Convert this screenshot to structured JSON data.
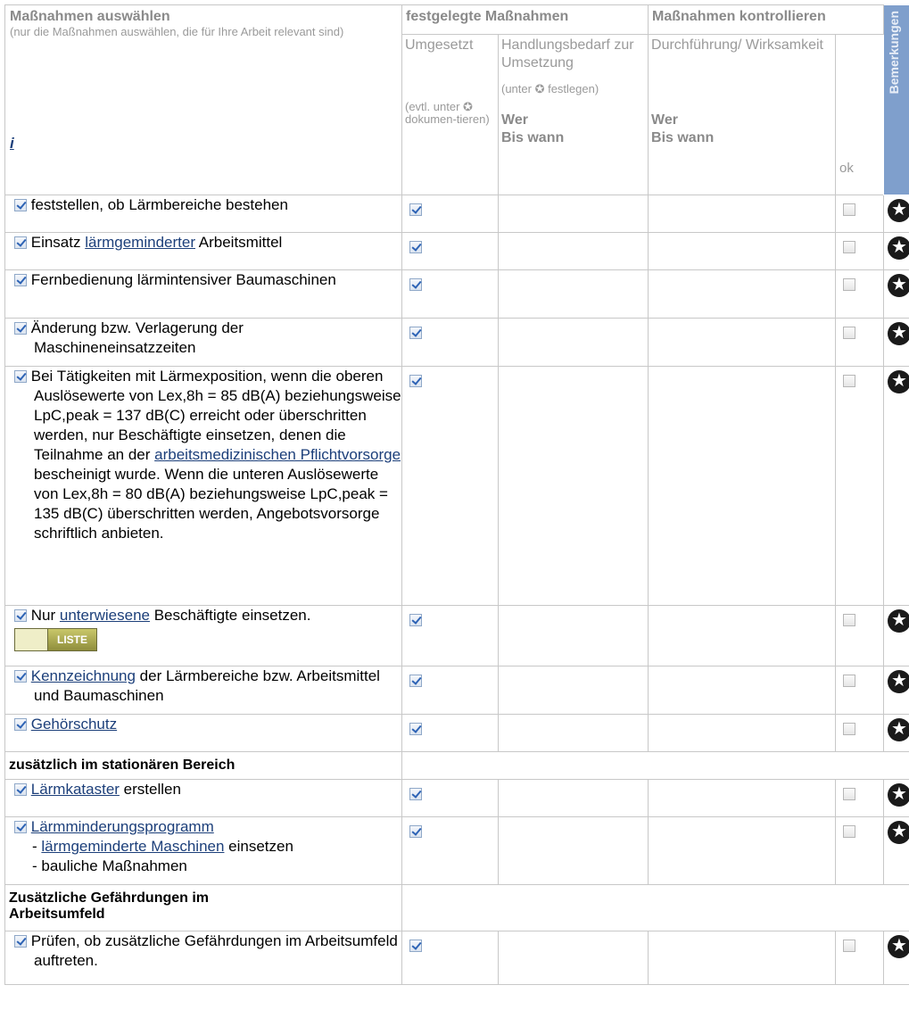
{
  "header": {
    "col1_title": "Maßnahmen auswählen",
    "col1_sub": "(nur die Maßnahmen auswählen, die für Ihre Arbeit relevant sind)",
    "info": "i",
    "group1": "festgelegte Maßnahmen",
    "group2": "Maßnahmen kontrollieren",
    "bemerkungen": "Bemerkungen",
    "umgesetzt": "Umgesetzt",
    "umgesetzt_note": "(evtl. unter ✪ dokumen-tieren)",
    "handlung": "Handlungsbedarf zur Umsetzung",
    "handlung_note": "(unter ✪ festlegen)",
    "wer": "Wer",
    "bis_wann": "Bis wann",
    "durchfuehrung": "Durchführung/ Wirksamkeit",
    "ok": "ok"
  },
  "rows": [
    {
      "pre": "",
      "link": "",
      "post": "feststellen, ob Lärmbereiche bestehen"
    },
    {
      "pre": "Einsatz ",
      "link": "lärmgeminderter",
      "post": " Arbeitsmittel"
    },
    {
      "pre": "",
      "link": "",
      "post": "Fernbedienung lärmintensiver Baumaschinen"
    },
    {
      "pre": "",
      "link": "",
      "post": "Änderung bzw. Verlagerung der Maschineneinsatzzeiten"
    },
    {
      "pre": "Bei Tätigkeiten mit Lärmexposition, wenn die oberen Auslösewerte von Lex,8h = 85 dB(A) beziehungsweise LpC,peak = 137 dB(C) erreicht oder überschritten werden, nur Beschäftigte einsetzen, denen die Teilnahme an der ",
      "link": "arbeitsmedizinischen Pflichtvorsorge",
      "post": " bescheinigt wurde. Wenn die unteren Auslösewerte von Lex,8h = 80 dB(A) beziehungsweise LpC,peak = 135 dB(C) überschritten werden, Angebotsvorsorge schriftlich anbieten."
    },
    {
      "pre": "Nur ",
      "link": "unterwiesene",
      "post": " Beschäftigte einsetzen."
    },
    {
      "pre": "",
      "link": "Kennzeichnung",
      "post": " der Lärmbereiche bzw. Arbeitsmittel und Baumaschinen"
    },
    {
      "pre": "",
      "link": "Gehörschutz",
      "post": ""
    }
  ],
  "liste_label": "LISTE",
  "section1": "zusätzlich im stationären Bereich",
  "rows2": [
    {
      "link": "Lärmkataster",
      "post": " erstellen"
    },
    {
      "link": "Lärmminderungsprogramm",
      "sub1_pre": "- ",
      "sub1_link": "lärmgeminderte Maschinen",
      "sub1_post": " einsetzen",
      "sub2": "- bauliche Maßnahmen"
    }
  ],
  "section2": "Zusätzliche Gefährdungen im Arbeitsumfeld",
  "rows3": [
    {
      "text": "Prüfen, ob zusätzliche Gefährdungen im Arbeitsumfeld auftreten."
    }
  ]
}
